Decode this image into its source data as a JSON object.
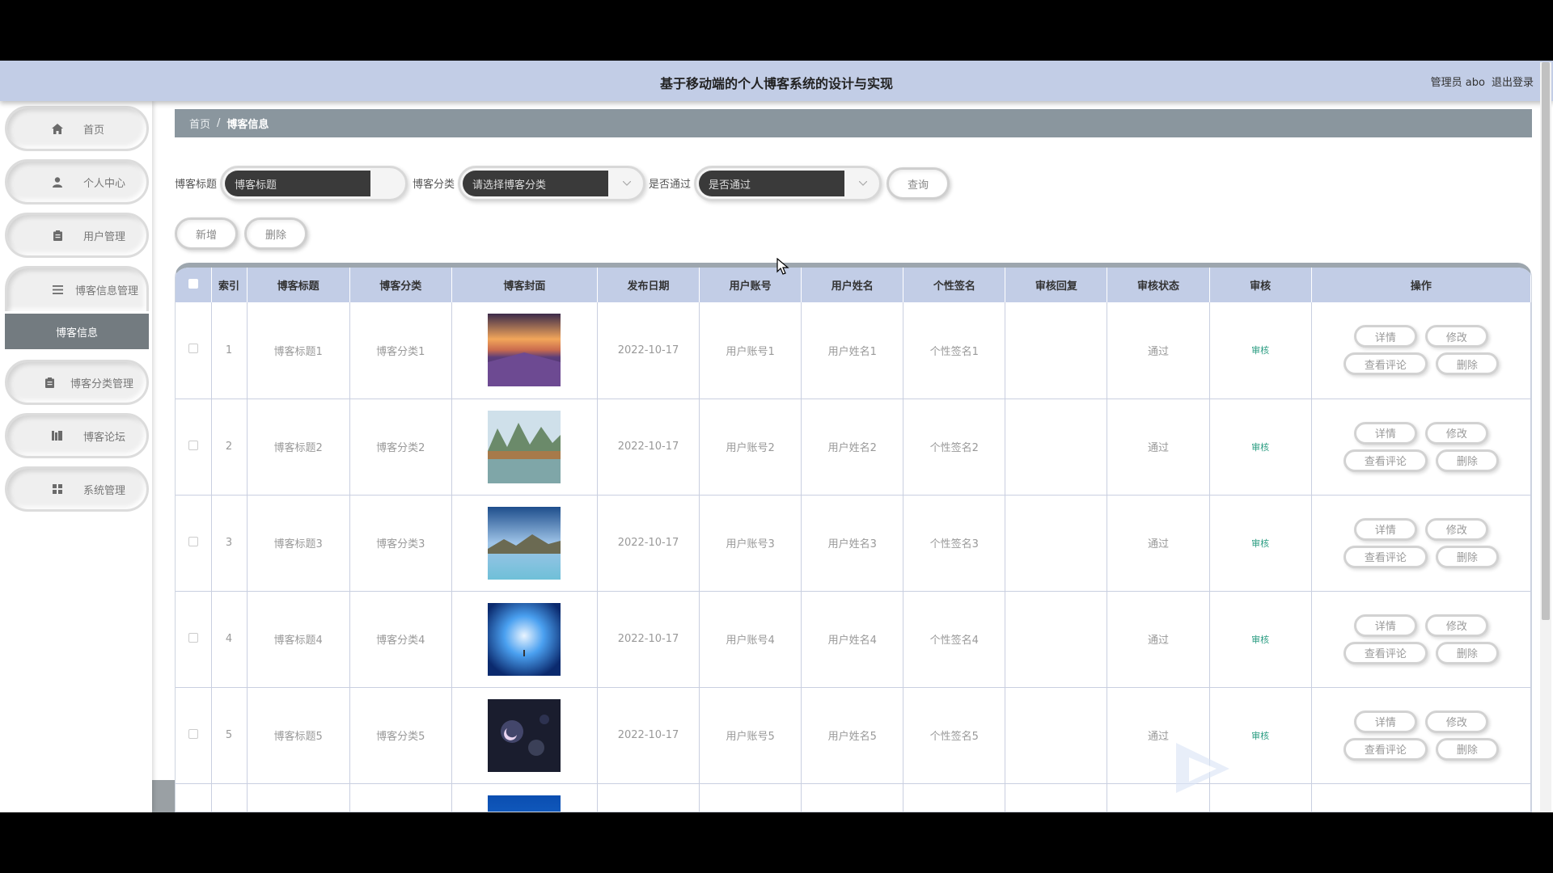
{
  "header": {
    "title": "基于移动端的个人博客系统的设计与实现",
    "user_label": "管理员 abo",
    "logout_label": "退出登录"
  },
  "sidebar": {
    "items": [
      {
        "label": "首页",
        "icon": "home-icon"
      },
      {
        "label": "个人中心",
        "icon": "user-icon"
      },
      {
        "label": "用户管理",
        "icon": "clipboard-icon"
      },
      {
        "label": "博客信息管理",
        "icon": "list-icon"
      },
      {
        "label": "博客分类管理",
        "icon": "clipboard-icon"
      },
      {
        "label": "博客论坛",
        "icon": "book-icon"
      },
      {
        "label": "系统管理",
        "icon": "grid-icon"
      }
    ],
    "active_sub": "博客信息"
  },
  "breadcrumb": {
    "home": "首页",
    "sep": "/",
    "current": "博客信息"
  },
  "search": {
    "title_label": "博客标题",
    "title_placeholder": "博客标题",
    "category_label": "博客分类",
    "category_placeholder": "请选择博客分类",
    "passed_label": "是否通过",
    "passed_placeholder": "是否通过",
    "query_label": "查询"
  },
  "actions": {
    "add_label": "新增",
    "delete_label": "删除"
  },
  "table": {
    "headers": [
      "索引",
      "博客标题",
      "博客分类",
      "博客封面",
      "发布日期",
      "用户账号",
      "用户姓名",
      "个性签名",
      "审核回复",
      "审核状态",
      "审核",
      "操作"
    ],
    "approve_label": "审核",
    "op_labels": {
      "detail": "详情",
      "edit": "修改",
      "comments": "查看评论",
      "delete": "删除"
    },
    "rows": [
      {
        "index": "1",
        "title": "博客标题1",
        "category": "博客分类1",
        "cover": "lavender-field",
        "date": "2022-10-17",
        "account": "用户账号1",
        "name": "用户姓名1",
        "signature": "个性签名1",
        "reply": "",
        "status": "通过"
      },
      {
        "index": "2",
        "title": "博客标题2",
        "category": "博客分类2",
        "cover": "karst-bridge",
        "date": "2022-10-17",
        "account": "用户账号2",
        "name": "用户姓名2",
        "signature": "个性签名2",
        "reply": "",
        "status": "通过"
      },
      {
        "index": "3",
        "title": "博客标题3",
        "category": "博客分类3",
        "cover": "mountain-lake",
        "date": "2022-10-17",
        "account": "用户账号3",
        "name": "用户姓名3",
        "signature": "个性签名3",
        "reply": "",
        "status": "通过"
      },
      {
        "index": "4",
        "title": "博客标题4",
        "category": "博客分类4",
        "cover": "blue-halo",
        "date": "2022-10-17",
        "account": "用户账号4",
        "name": "用户姓名4",
        "signature": "个性签名4",
        "reply": "",
        "status": "通过"
      },
      {
        "index": "5",
        "title": "博客标题5",
        "category": "博客分类5",
        "cover": "night-moon",
        "date": "2022-10-17",
        "account": "用户账号5",
        "name": "用户姓名5",
        "signature": "个性签名5",
        "reply": "",
        "status": "通过"
      },
      {
        "index": "",
        "title": "",
        "category": "",
        "cover": "blue-partial",
        "date": "",
        "account": "",
        "name": "",
        "signature": "",
        "reply": "",
        "status": ""
      }
    ]
  },
  "colors": {
    "header_bg": "#c2cde6",
    "breadcrumb_bg": "#8a969e",
    "active_menu_bg": "#737b80",
    "approve_link": "#2b9d82"
  }
}
